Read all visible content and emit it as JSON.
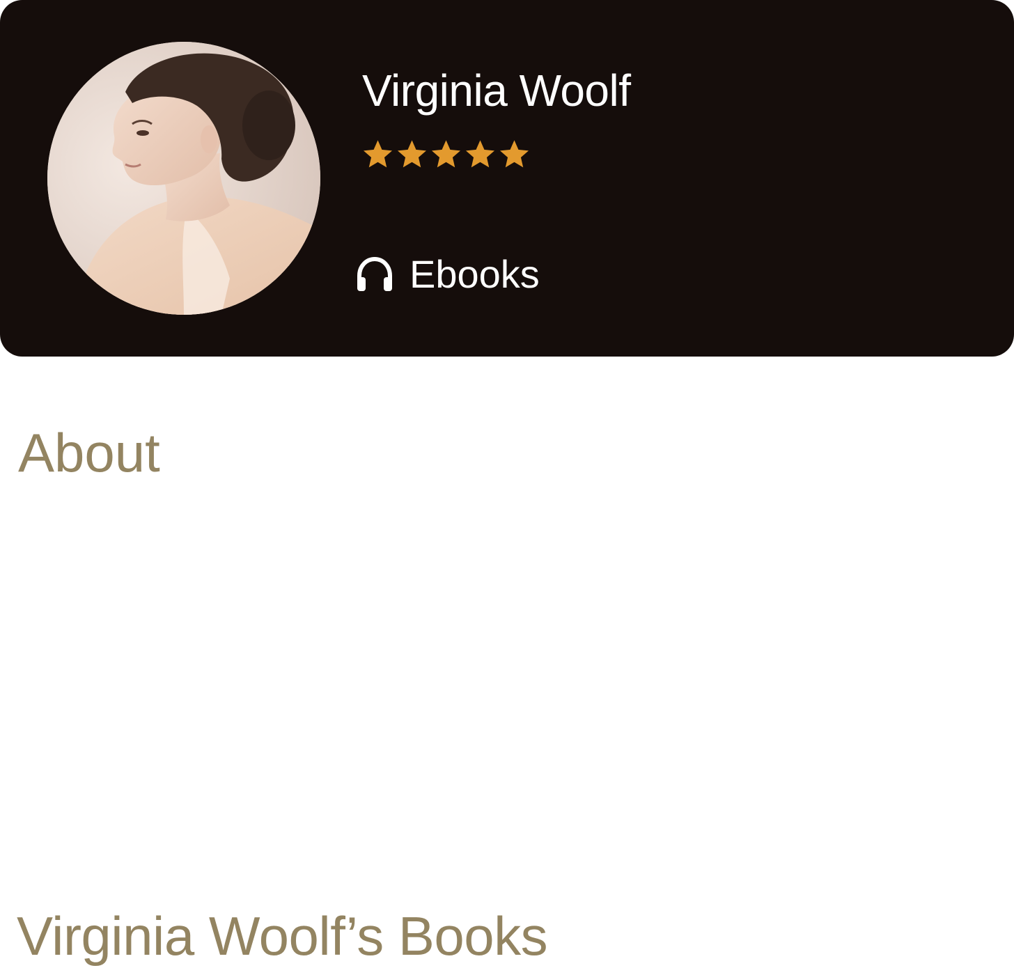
{
  "colors": {
    "header_background": "#150d0b",
    "header_text": "#ffffff",
    "star": "#e39a2e",
    "section_heading": "#938461",
    "page_background": "#ffffff"
  },
  "author": {
    "name": "Virginia Woolf",
    "rating": 5,
    "rating_max": 5,
    "photo": "author-portrait"
  },
  "format": {
    "icon": "headphones-icon",
    "label": "Ebooks"
  },
  "about": {
    "heading": "About"
  },
  "books": {
    "heading": "Virginia Woolf’s Books"
  }
}
